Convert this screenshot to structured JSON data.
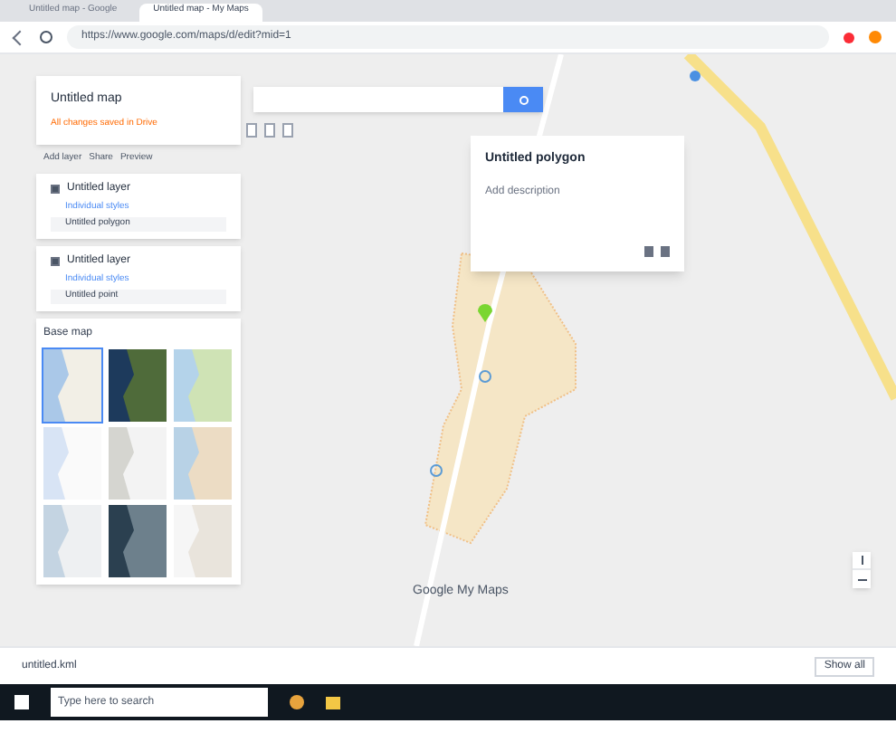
{
  "browser": {
    "tabs": [
      {
        "label": "Untitled map - Google",
        "selected": false
      },
      {
        "label": "Untitled map - My Maps",
        "selected": true
      }
    ],
    "url": "https://www.google.com/maps/d/edit?mid=1"
  },
  "panel": {
    "title": "Untitled map",
    "subtitle": "All changes saved in Drive",
    "actions": [
      "Add layer",
      "Share",
      "Preview"
    ],
    "layers": [
      {
        "name": "Untitled layer",
        "checked": true,
        "style": "Individual styles",
        "items": [
          "Untitled polygon"
        ]
      },
      {
        "name": "Untitled layer",
        "checked": true,
        "style": "Individual styles",
        "items": [
          "Untitled point"
        ]
      }
    ],
    "basemap": {
      "label": "Base map",
      "styles": [
        {
          "kind": "map",
          "selected": true
        },
        {
          "kind": "satellite",
          "selected": false
        },
        {
          "kind": "terrain",
          "selected": false
        },
        {
          "kind": "light",
          "selected": false
        },
        {
          "kind": "mono",
          "selected": false
        },
        {
          "kind": "atlas",
          "selected": false
        },
        {
          "kind": "political",
          "selected": false
        },
        {
          "kind": "dark",
          "selected": false
        },
        {
          "kind": "white",
          "selected": false
        }
      ]
    }
  },
  "popup": {
    "title": "Untitled polygon",
    "body": "Add description"
  },
  "map": {
    "labels": [
      "Google My Maps"
    ]
  },
  "download": {
    "file": "untitled.kml",
    "button": "Show all"
  },
  "taskbar": {
    "search": "Type here to search"
  }
}
